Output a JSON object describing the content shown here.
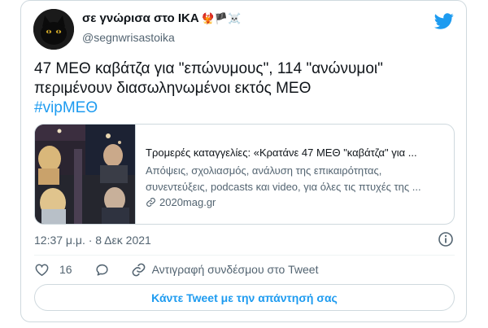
{
  "colors": {
    "accent": "#1d9bf0",
    "text_primary": "#0f1419",
    "text_secondary": "#536471",
    "border": "#cfd9de",
    "like_icon": "#e0245e"
  },
  "author": {
    "display_name": "σε γνώρισα στο ΙΚΑ",
    "name_emojis": "🐦‍🔥🏴☠️",
    "handle": "@segnwrisastoika",
    "avatar_icon": "black-cat-avatar"
  },
  "brand_icon": "twitter-bird-icon",
  "tweet": {
    "text": "47 ΜΕΘ καβάτζα για \"επώνυμους\", 114 \"ανώνυμοι\"\nπεριμένουν διασωληνωμένοι εκτός ΜΕΘ",
    "hashtag": "#vipΜΕΘ"
  },
  "link_card": {
    "title": "Τρομερές καταγγελίες: «Κρατάνε 47 ΜΕΘ \"καβάτζα\" για ...",
    "description_line1": "Απόψεις, σχολιασμός, ανάλυση της επικαιρότητας,",
    "description_line2": "συνεντεύξεις, podcasts και video, για όλες τις πτυχές της ...",
    "domain": "2020mag.gr"
  },
  "meta": {
    "timestamp": "12:37 μ.μ. · 8 Δεκ 2021"
  },
  "actions": {
    "like_count": "16",
    "copy_link_label": "Αντιγραφή συνδέσμου στο Tweet"
  },
  "reply_button": {
    "label": "Κάντε Tweet με την απάντησή σας"
  }
}
